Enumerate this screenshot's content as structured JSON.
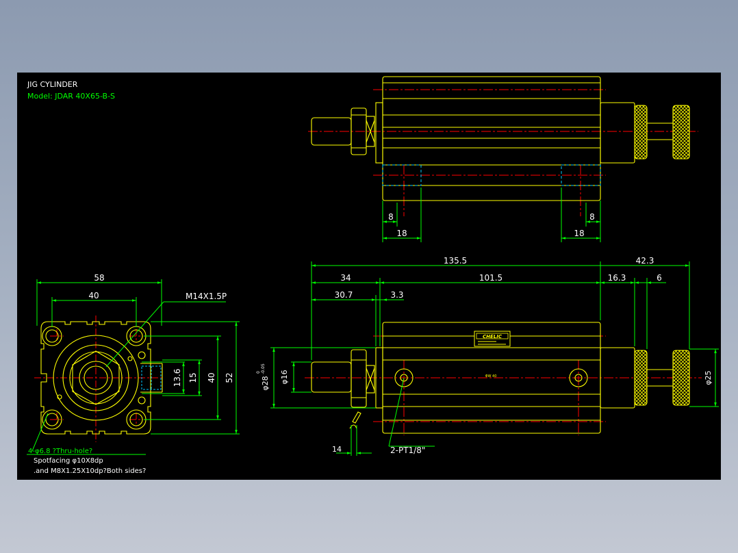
{
  "title_block": {
    "title": "JIG CYLINDER",
    "model": "Model: JDAR 40X65-B-S"
  },
  "colors": {
    "background": "#000000",
    "outline": "#ffff00",
    "dimension": "#00ff00",
    "center_line": "#ff0000",
    "hidden_line": "#00c8ff",
    "text_white": "#ffffff"
  },
  "top_view": {
    "dims": {
      "left_8": "8",
      "left_18": "18",
      "right_8": "8",
      "right_18": "18"
    }
  },
  "front_view": {
    "dims": {
      "overall_1355": "135.5",
      "body_1015": "101.5",
      "rod_34": "34",
      "rod_307": "30.7",
      "step_33": "3.3",
      "tail_423": "42.3",
      "tail_163": "16.3",
      "tail_6": "6",
      "rod_dia": "φ16",
      "boss_dia": "φ28",
      "boss_tol_upper": "0",
      "boss_tol_lower": "-0.05",
      "knob_dia": "φ25",
      "nut_14": "14"
    },
    "port_note": "2-PT1/8\"",
    "brand_label": "CHELIC",
    "body_mark": "ΦW 40"
  },
  "side_view": {
    "dims": {
      "w58": "58",
      "w40": "40",
      "h136": "13.6",
      "h15": "15",
      "h40": "40",
      "h52": "52"
    },
    "thread_note": "M14X1.5P",
    "hole_note_1": "4-φ6.8 ?Thru-hole?",
    "hole_note_2": "Spotfacing  φ10X8dp",
    "hole_note_3": ".and M8X1.25X10dp?Both sides?"
  }
}
